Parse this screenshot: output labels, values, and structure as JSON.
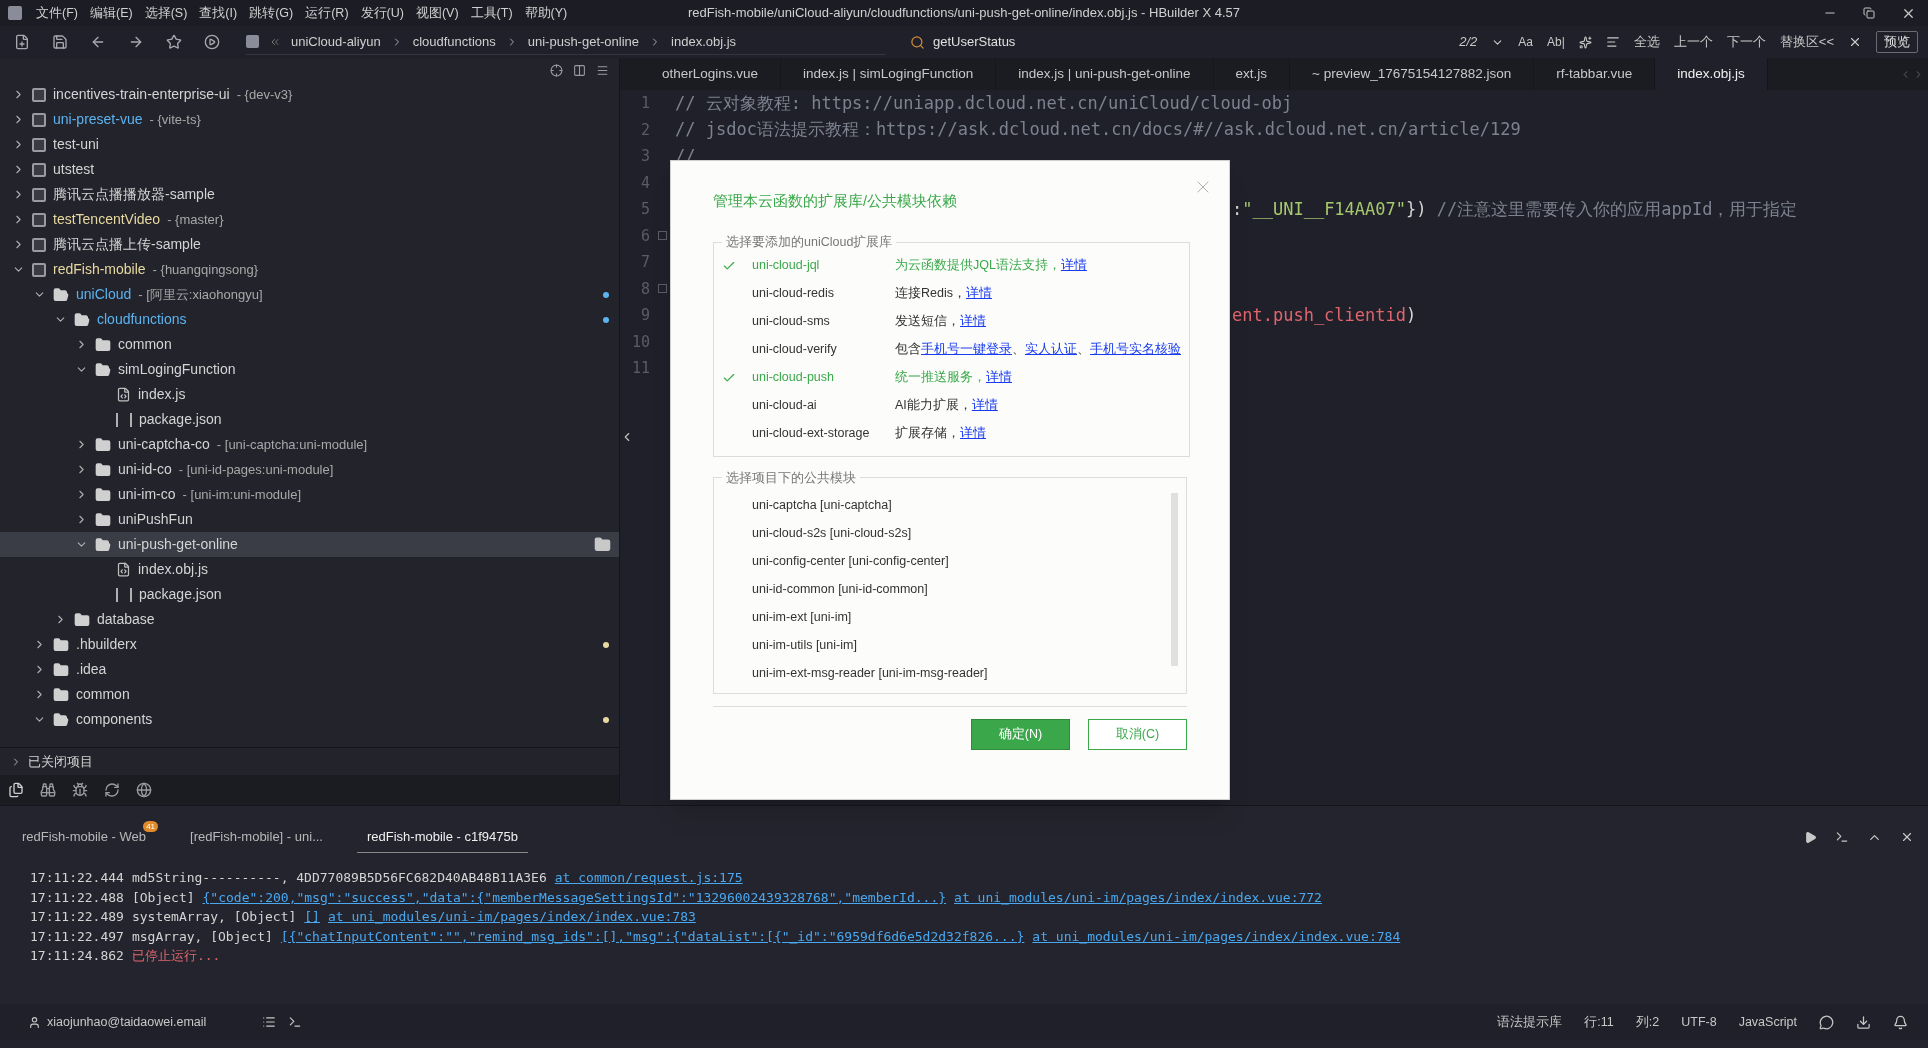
{
  "window": {
    "title": "redFish-mobile/uniCloud-aliyun/cloudfunctions/uni-push-get-online/index.obj.js - HBuilder X 4.57"
  },
  "menu": [
    "文件(F)",
    "编辑(E)",
    "选择(S)",
    "查找(I)",
    "跳转(G)",
    "运行(R)",
    "发行(U)",
    "视图(V)",
    "工具(T)",
    "帮助(Y)"
  ],
  "breadcrumb": [
    "uniCloud-aliyun",
    "cloudfunctions",
    "uni-push-get-online",
    "index.obj.js"
  ],
  "find": {
    "value": "getUserStatus",
    "count": "2/2",
    "options": [
      "Aa",
      "Ab|"
    ],
    "actions": [
      "全选",
      "上一个",
      "下一个",
      "替换区<<"
    ],
    "preview": "预览"
  },
  "tree": [
    {
      "kind": "project",
      "name": "incentives-train-enterprise-ui",
      "suffix": " - {dev-v3}",
      "color": "#d4d4d4",
      "expanded": false,
      "selected": false
    },
    {
      "kind": "project",
      "name": "uni-preset-vue",
      "suffix": " - {vite-ts}",
      "color": "#5cb3f0",
      "expanded": false,
      "selected": false
    },
    {
      "kind": "project",
      "name": "test-uni",
      "color": "#d4d4d4",
      "expanded": false,
      "selected": false
    },
    {
      "kind": "project",
      "name": "utstest",
      "color": "#d4d4d4",
      "expanded": false,
      "selected": false
    },
    {
      "kind": "project",
      "name": "腾讯云点播播放器-sample",
      "color": "#d4d4d4",
      "expanded": false,
      "selected": false
    },
    {
      "kind": "project",
      "name": "testTencentVideo",
      "suffix": " - {master}",
      "color": "#e8d9a0",
      "expanded": false,
      "selected": false
    },
    {
      "kind": "project",
      "name": "腾讯云点播上传-sample",
      "color": "#d4d4d4",
      "expanded": false,
      "selected": false
    },
    {
      "kind": "project",
      "name": "redFish-mobile",
      "suffix": " - {huangqingsong}",
      "color": "#e8d9a0",
      "expanded": true,
      "selected": false,
      "children": [
        {
          "kind": "folder",
          "name": "uniCloud",
          "suffix": " - [阿里云:xiaohongyu]",
          "color": "#5cb3f0",
          "dot": {
            "color": "#5cb3f0"
          },
          "expanded": true,
          "selected": false,
          "children": [
            {
              "kind": "folder",
              "name": "cloudfunctions",
              "color": "#5cb3f0",
              "dot": {
                "color": "#5cb3f0"
              },
              "expanded": true,
              "selected": false,
              "children": [
                {
                  "kind": "folder",
                  "name": "common",
                  "color": "#d4d4d4",
                  "expanded": false,
                  "selected": false
                },
                {
                  "kind": "folder",
                  "name": "simLogingFunction",
                  "color": "#d4d4d4",
                  "expanded": true,
                  "selected": false,
                  "children": [
                    {
                      "kind": "file",
                      "name": "index.js",
                      "color": "#d4d4d4",
                      "selected": false
                    },
                    {
                      "kind": "json",
                      "name": "package.json",
                      "color": "#d4d4d4",
                      "selected": false
                    }
                  ]
                },
                {
                  "kind": "folder",
                  "name": "uni-captcha-co",
                  "suffix": " - [uni-captcha:uni-module]",
                  "color": "#d4d4d4",
                  "expanded": false,
                  "selected": false
                },
                {
                  "kind": "folder",
                  "name": "uni-id-co",
                  "suffix": " - [uni-id-pages:uni-module]",
                  "color": "#d4d4d4",
                  "expanded": false,
                  "selected": false
                },
                {
                  "kind": "folder",
                  "name": "uni-im-co",
                  "suffix": " - [uni-im:uni-module]",
                  "color": "#d4d4d4",
                  "expanded": false,
                  "selected": false
                },
                {
                  "kind": "folder",
                  "name": "uniPushFun",
                  "color": "#d4d4d4",
                  "expanded": false,
                  "selected": false
                },
                {
                  "kind": "folder",
                  "name": "uni-push-get-online",
                  "color": "#d4d4d4",
                  "expanded": true,
                  "selected": true,
                  "children": [
                    {
                      "kind": "file",
                      "name": "index.obj.js",
                      "color": "#d4d4d4",
                      "selected": false
                    },
                    {
                      "kind": "json",
                      "name": "package.json",
                      "color": "#d4d4d4",
                      "selected": false
                    }
                  ]
                }
              ]
            },
            {
              "kind": "folder",
              "name": "database",
              "color": "#d4d4d4",
              "expanded": false,
              "selected": false
            }
          ]
        },
        {
          "kind": "folder",
          "name": ".hbuilderx",
          "color": "#d4d4d4",
          "dot": {
            "color": "#e8d9a0"
          },
          "expanded": false,
          "selected": false
        },
        {
          "kind": "folder",
          "name": ".idea",
          "color": "#d4d4d4",
          "expanded": false,
          "selected": false
        },
        {
          "kind": "folder",
          "name": "common",
          "color": "#d4d4d4",
          "expanded": false,
          "selected": false
        },
        {
          "kind": "folder",
          "name": "components",
          "color": "#d4d4d4",
          "dot": {
            "color": "#e8d9a0"
          },
          "expanded": true,
          "selected": false
        }
      ]
    }
  ],
  "closed_projects": "已关闭项目",
  "tabs": [
    {
      "label": "otherLogins.vue",
      "selected": false
    },
    {
      "label": "index.js | simLogingFunction",
      "selected": false
    },
    {
      "label": "index.js | uni-push-get-online",
      "selected": false
    },
    {
      "label": "ext.js",
      "selected": false
    },
    {
      "label": "~ preview_17675154127882.json",
      "selected": false
    },
    {
      "label": "rf-tabbar.vue",
      "selected": false
    },
    {
      "label": "index.obj.js",
      "selected": true
    }
  ],
  "code": [
    {
      "number": "1",
      "kind": "comment",
      "text": "// 云对象教程: https://uniapp.dcloud.net.cn/uniCloud/cloud-obj"
    },
    {
      "number": "2",
      "kind": "comment",
      "text": "// jsdoc语法提示教程：https://ask.dcloud.net.cn/docs/#//ask.dcloud.net.cn/article/129"
    },
    {
      "number": "3",
      "kind": "comment",
      "text": "//"
    },
    {
      "number": "4"
    },
    {
      "number": "5",
      "kind": "appid",
      "parts": [
        {
          "kind": "plain",
          "text": ":"
        },
        {
          "kind": "string",
          "text": "\"__UNI__F14AA07\""
        },
        {
          "kind": "plain",
          "text": "}) "
        },
        {
          "kind": "comment",
          "text": "//注意这里需要传入你的应用appId，用于指定"
        }
      ]
    },
    {
      "number": "6",
      "fold": true
    },
    {
      "number": "7"
    },
    {
      "number": "8",
      "fold": true
    },
    {
      "number": "9",
      "kind": "call",
      "parts": [
        {
          "kind": "error",
          "text": "ent.push_clientid"
        },
        {
          "kind": "plain",
          "text": ")"
        }
      ]
    },
    {
      "number": "10"
    },
    {
      "number": "11"
    }
  ],
  "dialog": {
    "title": "管理本云函数的扩展库/公共模块依赖",
    "extensions": {
      "legend": "选择要添加的uniCloud扩展库",
      "items": [
        {
          "name": "uni-cloud-jql",
          "checked": true,
          "description": [
            {
              "kind": "text",
              "text": "为云函数提供JQL语法支持，"
            },
            {
              "kind": "link",
              "text": "详情"
            }
          ]
        },
        {
          "name": "uni-cloud-redis",
          "checked": false,
          "description": [
            {
              "kind": "text",
              "text": "连接Redis，"
            },
            {
              "kind": "link",
              "text": "详情"
            }
          ]
        },
        {
          "name": "uni-cloud-sms",
          "checked": false,
          "description": [
            {
              "kind": "text",
              "text": "发送短信，"
            },
            {
              "kind": "link",
              "text": "详情"
            }
          ]
        },
        {
          "name": "uni-cloud-verify",
          "checked": false,
          "description": [
            {
              "kind": "text",
              "text": "包含"
            },
            {
              "kind": "link",
              "text": "手机号一键登录"
            },
            {
              "kind": "text",
              "text": "、"
            },
            {
              "kind": "link",
              "text": "实人认证"
            },
            {
              "kind": "text",
              "text": "、"
            },
            {
              "kind": "link",
              "text": "手机号实名核验"
            }
          ]
        },
        {
          "name": "uni-cloud-push",
          "checked": true,
          "description": [
            {
              "kind": "text",
              "text": "统一推送服务，"
            },
            {
              "kind": "link",
              "text": "详情"
            }
          ]
        },
        {
          "name": "uni-cloud-ai",
          "checked": false,
          "description": [
            {
              "kind": "text",
              "text": "AI能力扩展，"
            },
            {
              "kind": "link",
              "text": "详情"
            }
          ]
        },
        {
          "name": "uni-cloud-ext-storage",
          "checked": false,
          "description": [
            {
              "kind": "text",
              "text": "扩展存储，"
            },
            {
              "kind": "link",
              "text": "详情"
            }
          ]
        }
      ]
    },
    "modules": {
      "legend": "选择项目下的公共模块",
      "items": [
        "uni-captcha [uni-captcha]",
        "uni-cloud-s2s [uni-cloud-s2s]",
        "uni-config-center [uni-config-center]",
        "uni-id-common [uni-id-common]",
        "uni-im-ext [uni-im]",
        "uni-im-utils [uni-im]",
        "uni-im-ext-msg-reader [uni-im-msg-reader]"
      ]
    },
    "buttons": [
      {
        "label": "确定(N)",
        "kind": "primary"
      },
      {
        "label": "取消(C)",
        "kind": "secondary"
      }
    ]
  },
  "console": {
    "tabs": [
      {
        "label": "redFish-mobile - Web",
        "badge": "41",
        "selected": false
      },
      {
        "label": "[redFish-mobile] - uni...",
        "selected": false
      },
      {
        "label": "redFish-mobile - c1f9475b",
        "selected": true
      }
    ],
    "lines": [
      {
        "time": "17:11:22.444",
        "parts": [
          {
            "kind": "text",
            "text": "md5String----------,  4DD77089B5D56FC682D40AB48B11A3E6"
          },
          {
            "kind": "link",
            "text": "at common/request.js:175"
          }
        ]
      },
      {
        "time": "17:11:22.488",
        "parts": [
          {
            "kind": "text",
            "text": "[Object]"
          },
          {
            "kind": "link",
            "text": "{\"code\":200,\"msg\":\"success\",\"data\":{\"memberMessageSettingsId\":\"13296002439328768\",\"memberId...}"
          },
          {
            "kind": "link",
            "text": "at uni_modules/uni-im/pages/index/index.vue:772"
          }
        ]
      },
      {
        "time": "17:11:22.489",
        "parts": [
          {
            "kind": "text",
            "text": "systemArray,  [Object]"
          },
          {
            "kind": "link",
            "text": "[]"
          },
          {
            "kind": "link",
            "text": "at uni_modules/uni-im/pages/index/index.vue:783"
          }
        ]
      },
      {
        "time": "17:11:22.497",
        "parts": [
          {
            "kind": "text",
            "text": "msgArray,  [Object]"
          },
          {
            "kind": "link",
            "text": "[{\"chatInputContent\":\"\",\"remind_msg_ids\":[],\"msg\":{\"dataList\":[{\"_id\":\"6959df6d6e5d2d32f826...}"
          },
          {
            "kind": "link",
            "text": "at uni_modules/uni-im/pages/index/index.vue:784"
          }
        ]
      },
      {
        "time": "17:11:24.862",
        "parts": [
          {
            "kind": "error",
            "text": "已停止运行..."
          }
        ]
      }
    ]
  },
  "status_bar": {
    "account": "xiaojunhao@taidaowei.email",
    "items": [
      "语法提示库",
      "行:11",
      "列:2",
      "UTF-8",
      "JavaScript"
    ]
  }
}
